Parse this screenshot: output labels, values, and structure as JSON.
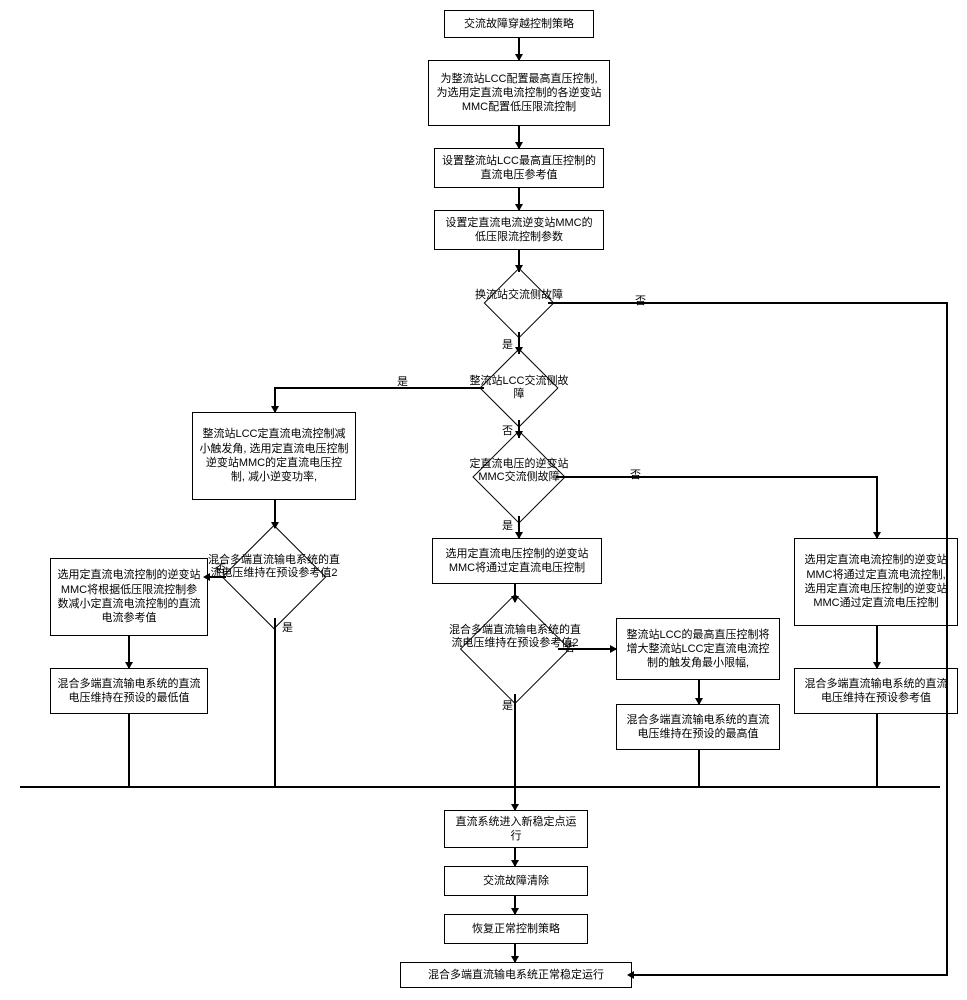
{
  "nodes": {
    "n1": "交流故障穿越控制策略",
    "n2": "为整流站LCC配置最高直压控制, 为选用定直流电流控制的各逆变站MMC配置低压限流控制",
    "n3": "设置整流站LCC最高直压控制的直流电压参考值",
    "n4": "设置定直流电流逆变站MMC的低压限流控制参数",
    "d1": "换流站交流侧故障",
    "d2": "整流站LCC交流侧故障",
    "d3": "定直流电压的逆变站MMC交流侧故障",
    "n5": "整流站LCC定直流电流控制减小触发角, 选用定直流电压控制逆变站MMC的定直流电压控制, 减小逆变功率,",
    "d4": "混合多端直流输电系统的直流电压维持在预设参考值2",
    "n6": "选用定直流电流控制的逆变站MMC将根据低压限流控制参数减小定直流电流控制的直流电流参考值",
    "n7": "混合多端直流输电系统的直流电压维持在预设的最低值",
    "n8": "选用定直流电压控制的逆变站MMC将通过定直流电压控制",
    "d5": "混合多端直流输电系统的直流电压维持在预设参考值2",
    "n9": "整流站LCC的最高直压控制将增大整流站LCC定直流电流控制的触发角最小限幅,",
    "n10": "混合多端直流输电系统的直流电压维持在预设的最高值",
    "n11": "选用定直流电流控制的逆变站MMC将通过定直流电流控制, 选用定直流电压控制的逆变站MMC通过定直流电压控制",
    "n12": "混合多端直流输电系统的直流电压维持在预设参考值",
    "n13": "直流系统进入新稳定点运行",
    "n14": "交流故障清除",
    "n15": "恢复正常控制策略",
    "n16": "混合多端直流输电系统正常稳定运行"
  },
  "edges": {
    "yes": "是",
    "no": "否"
  }
}
